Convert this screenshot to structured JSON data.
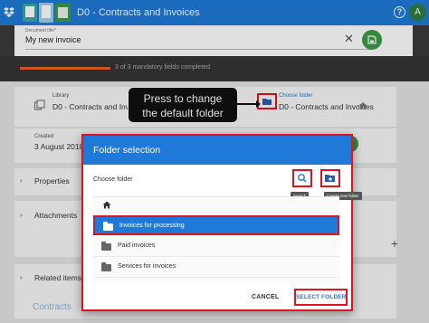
{
  "appbar": {
    "title": "D0 - Contracts and Invoices",
    "help_glyph": "?",
    "avatar_initial": "A",
    "color": "#1e79d9"
  },
  "document": {
    "title_label": "Document title*",
    "title_value": "My new invoice",
    "close_glyph": "✕"
  },
  "progress": {
    "text": "3 of 3 mandatory fields completed",
    "completed": 3,
    "total": 3,
    "accent": "#e8621c"
  },
  "library": {
    "label": "Library",
    "value": "D0 - Contracts and Invoices",
    "choose_folder_label": "Choose folder",
    "choose_folder_value": "D0 - Contracts and Invoices"
  },
  "created": {
    "label": "Created",
    "value": "3 August 2018"
  },
  "sections": {
    "properties": "Properties",
    "attachments": "Attachments",
    "related": "Related items",
    "contracts": "Contracts"
  },
  "callout": {
    "line1": "Press to change",
    "line2": "the default folder"
  },
  "modal": {
    "title": "Folder selection",
    "choose_label": "Choose folder",
    "search_tooltip": "Search",
    "new_folder_tooltip": "Create new folder",
    "folders": [
      {
        "label": "Invoices for processing",
        "selected": true
      },
      {
        "label": "Paid invoices",
        "selected": false
      },
      {
        "label": "Services for invoices",
        "selected": false
      }
    ],
    "cancel_label": "CANCEL",
    "select_label": "SELECT FOLDER"
  },
  "icons": {
    "home": "home-icon",
    "search": "search-icon",
    "new_folder": "new-folder-icon",
    "folder": "folder-icon"
  },
  "colors": {
    "highlight": "#e0141e",
    "save_green": "#3c9a45"
  }
}
